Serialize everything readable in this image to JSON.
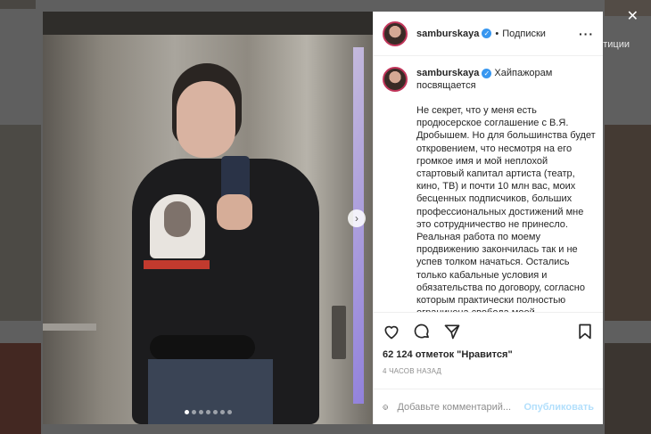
{
  "background": {
    "partial_caption": "тиции"
  },
  "post": {
    "username": "samburskaya",
    "follow_label": "Подписки",
    "caption_title": "Хайпажорам посвящается",
    "caption_body": "Не секрет, что у меня есть продюсерское соглашение с В.Я. Дробышем. Но для большинства будет откровением, что несмотря на его громкое имя и мой неплохой стартовый капитал артиста (театр, кино, ТВ) и почти 10 млн вас, моих бесценных подписчиков, больших профессиональных достижений мне это сотрудничество не принесло. Реальная работа по моему продвижению закончилась так и не успев толком начаться. Остались только кабальные условия и обязательства по договору, согласно которым практически полностью ограничена свобода моей",
    "likes_text": "62 124 отметок \"Нравится\"",
    "time_text": "4 ЧАСОВ НАЗАД",
    "photo_count": 7,
    "active_photo": 1
  },
  "comment": {
    "placeholder": "Добавьте комментарий...",
    "post_label": "Опубликовать"
  },
  "icons": {
    "more": "more-icon",
    "verified": "verified-icon",
    "like": "heart-icon",
    "comment": "comment-icon",
    "share": "share-icon",
    "save": "bookmark-icon",
    "emoji": "smile-icon",
    "next": "chevron-right-icon"
  },
  "colors": {
    "verified": "#3897f0",
    "post_button": "#b2dffc"
  }
}
